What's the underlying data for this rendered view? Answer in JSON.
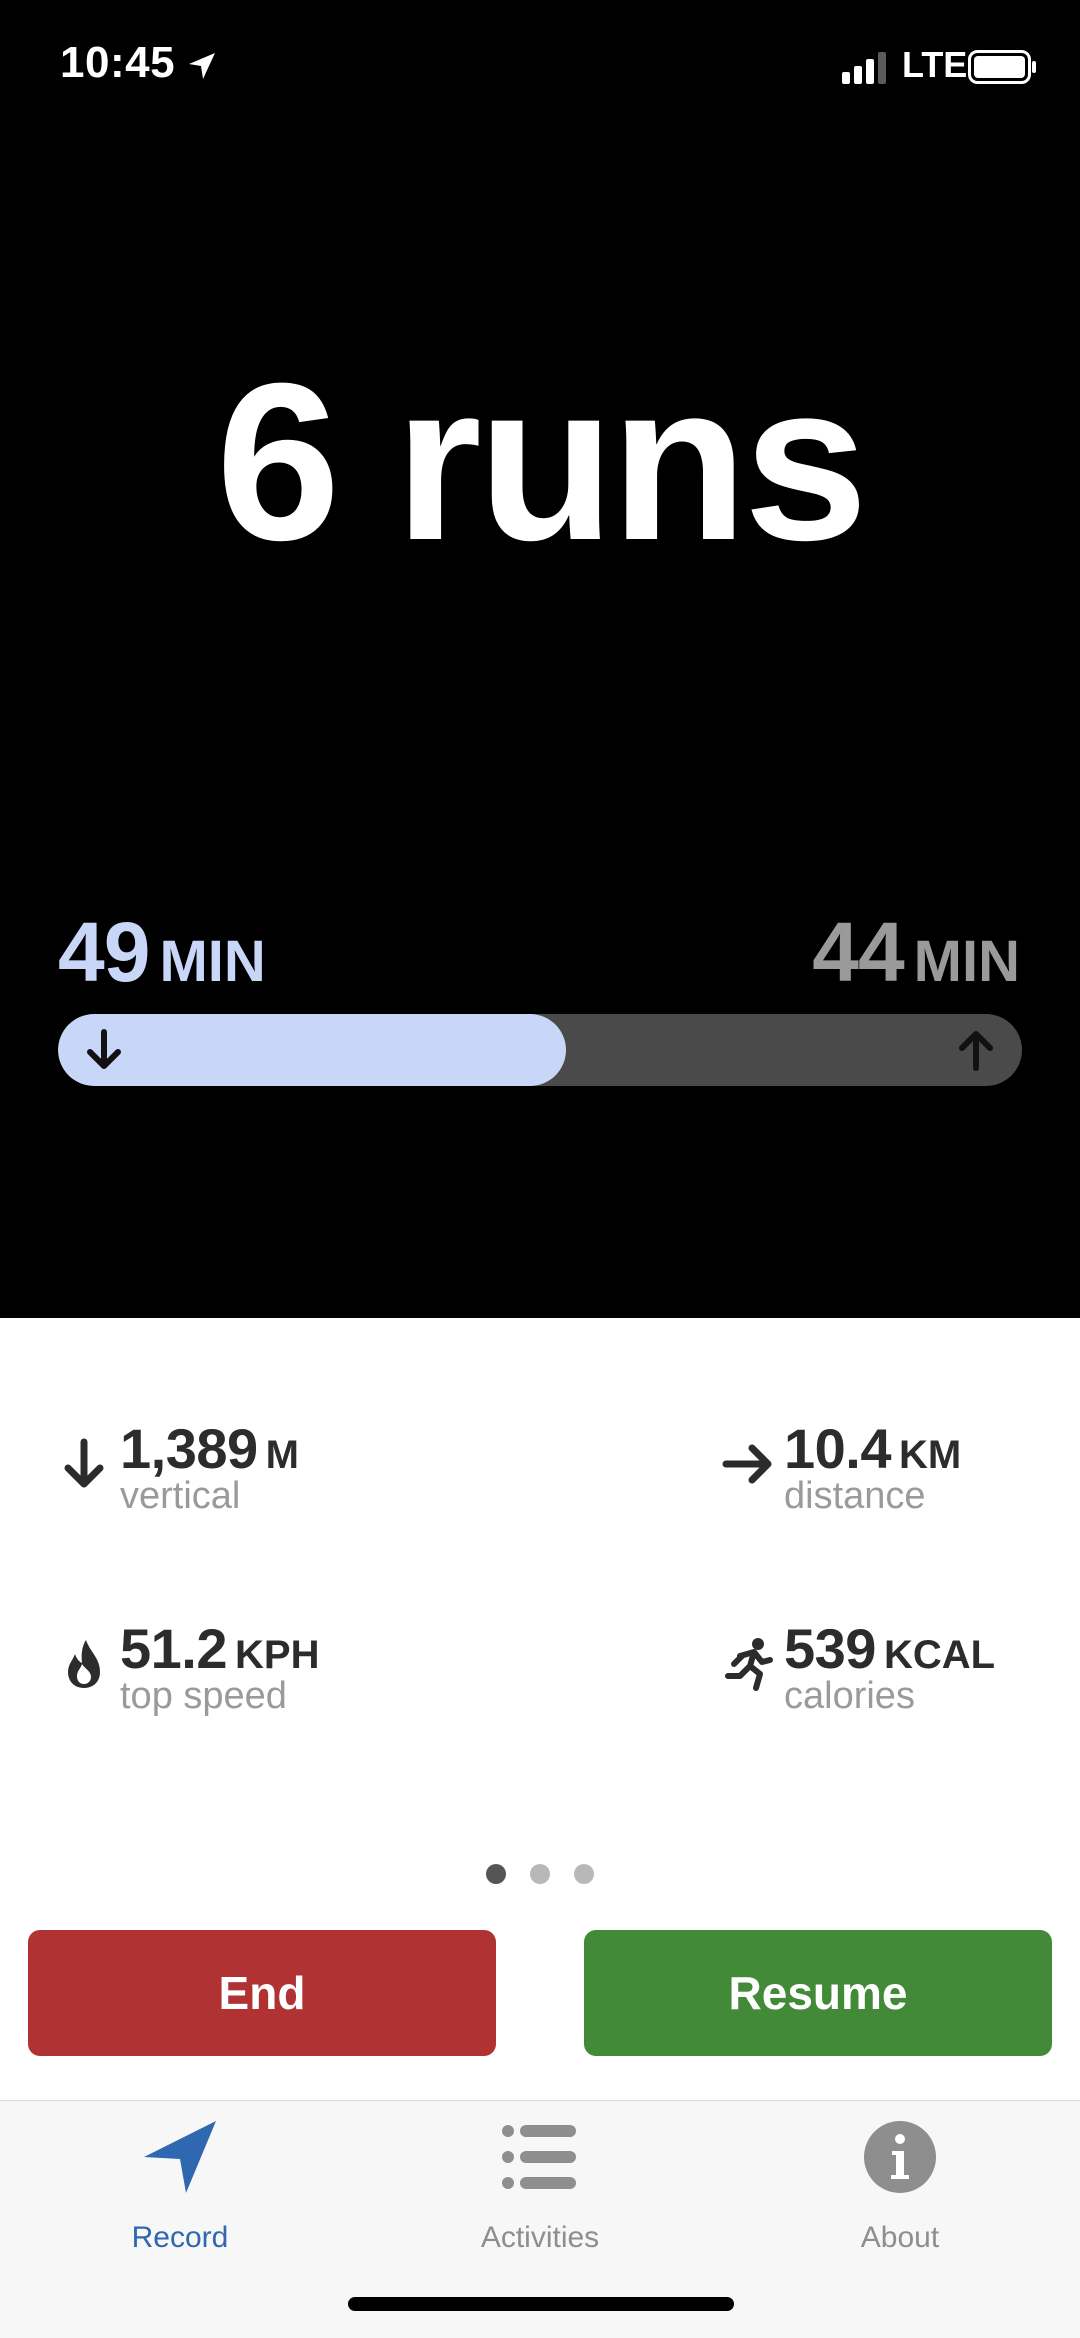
{
  "status_bar": {
    "time": "10:45",
    "network": "LTE",
    "icons": [
      "location-arrow-icon",
      "signal-icon",
      "battery-icon"
    ]
  },
  "summary": {
    "runs_label": "6 runs"
  },
  "time_split": {
    "down_value": "49",
    "down_unit": "MIN",
    "up_value": "44",
    "up_unit": "MIN",
    "down_fraction": 0.527,
    "down_color": "#c8d6f8",
    "up_color": "#9a9a9a"
  },
  "stats": [
    {
      "icon": "arrow-down-icon",
      "value": "1,389",
      "unit": "M",
      "label": "vertical"
    },
    {
      "icon": "arrow-right-icon",
      "value": "10.4",
      "unit": "KM",
      "label": "distance"
    },
    {
      "icon": "flame-icon",
      "value": "51.2",
      "unit": "KPH",
      "label": "top speed"
    },
    {
      "icon": "running-person-icon",
      "value": "539",
      "unit": "KCAL",
      "label": "calories"
    }
  ],
  "pager": {
    "count": 3,
    "active": 0
  },
  "buttons": {
    "end_label": "End",
    "resume_label": "Resume",
    "end_color": "#b03232",
    "resume_color": "#428a38"
  },
  "tabs": [
    {
      "label": "Record",
      "icon": "navigation-arrow-icon",
      "active": true
    },
    {
      "label": "Activities",
      "icon": "list-icon",
      "active": false
    },
    {
      "label": "About",
      "icon": "info-icon",
      "active": false
    }
  ],
  "colors": {
    "accent": "#2f67b0"
  }
}
